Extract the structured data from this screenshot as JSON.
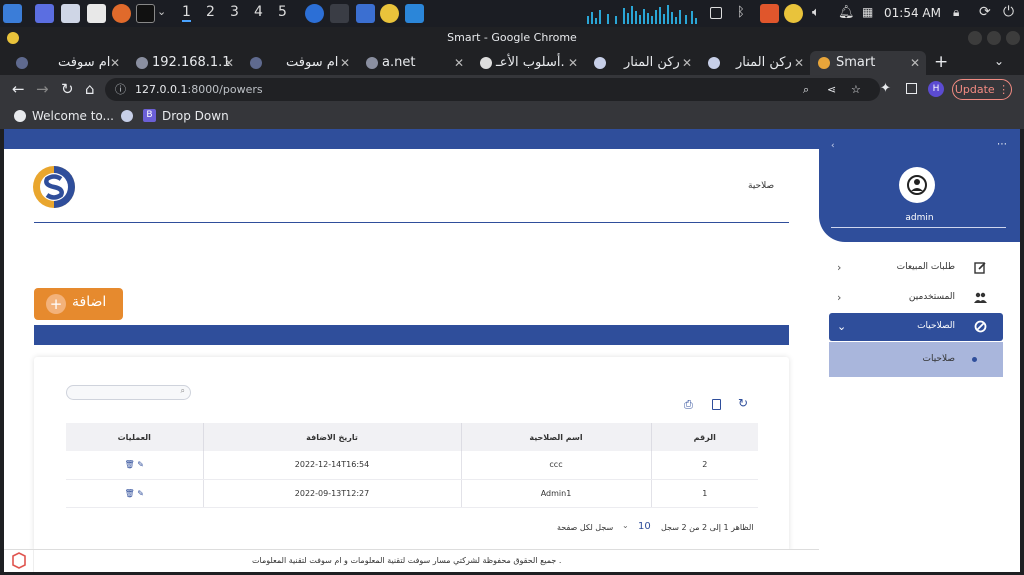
{
  "taskbar": {
    "workspaces": [
      "1",
      "2",
      "3",
      "4",
      "5"
    ],
    "clock": "01:54 AM"
  },
  "window": {
    "title": "Smart - Google Chrome"
  },
  "tabs": [
    {
      "label": "ام سوفت"
    },
    {
      "label": "192.168.1.1"
    },
    {
      "label": "ام سوفت"
    },
    {
      "label": "a.net"
    },
    {
      "label": "أسلوب الأعـ."
    },
    {
      "label": "ركن المنار"
    },
    {
      "label": "ركن المنار"
    },
    {
      "label": "Smart"
    }
  ],
  "toolbar": {
    "url_host": "127.0.0.1",
    "url_rest": ":8000/powers",
    "profile_initial": "H",
    "update_label": "Update"
  },
  "bookmarks": [
    {
      "label": "Welcome to..."
    },
    {
      "label": "Drop Down"
    }
  ],
  "page": {
    "heading": "صلاحية",
    "add_button": "اضافة",
    "add_symbol": "+"
  },
  "sidebar": {
    "user": "admin",
    "items": [
      {
        "label": "طلبات المبيعات",
        "icon": "edit-icon"
      },
      {
        "label": "المستخدمين",
        "icon": "users-icon"
      },
      {
        "label": "الصلاحيات",
        "icon": "ban-icon"
      }
    ],
    "subitem": "صلاحيات"
  },
  "table": {
    "columns": [
      "الرقم",
      "اسم الصلاحية",
      "تاريخ الاضافة",
      "العمليات"
    ],
    "rows": [
      {
        "id": "2",
        "name": "ccc",
        "date": "2022-12-14T16:54"
      },
      {
        "id": "1",
        "name": "Admin1",
        "date": "2022-09-13T12:27"
      }
    ]
  },
  "pagination": {
    "summary": "الظاهر 1 إلى 2 من 2 سجل",
    "page_size": "10",
    "per_page_label": "سجل لكل صفحة"
  },
  "footer": {
    "text": "جميع الحقوق محفوظة لشركتي مسار سوفت لتقنية المعلومات و ام سوفت لتقنية المعلومات ."
  },
  "colors": {
    "primary": "#2f4e9b",
    "accent": "#e68a2e",
    "active_sub": "#a9b6dc"
  }
}
